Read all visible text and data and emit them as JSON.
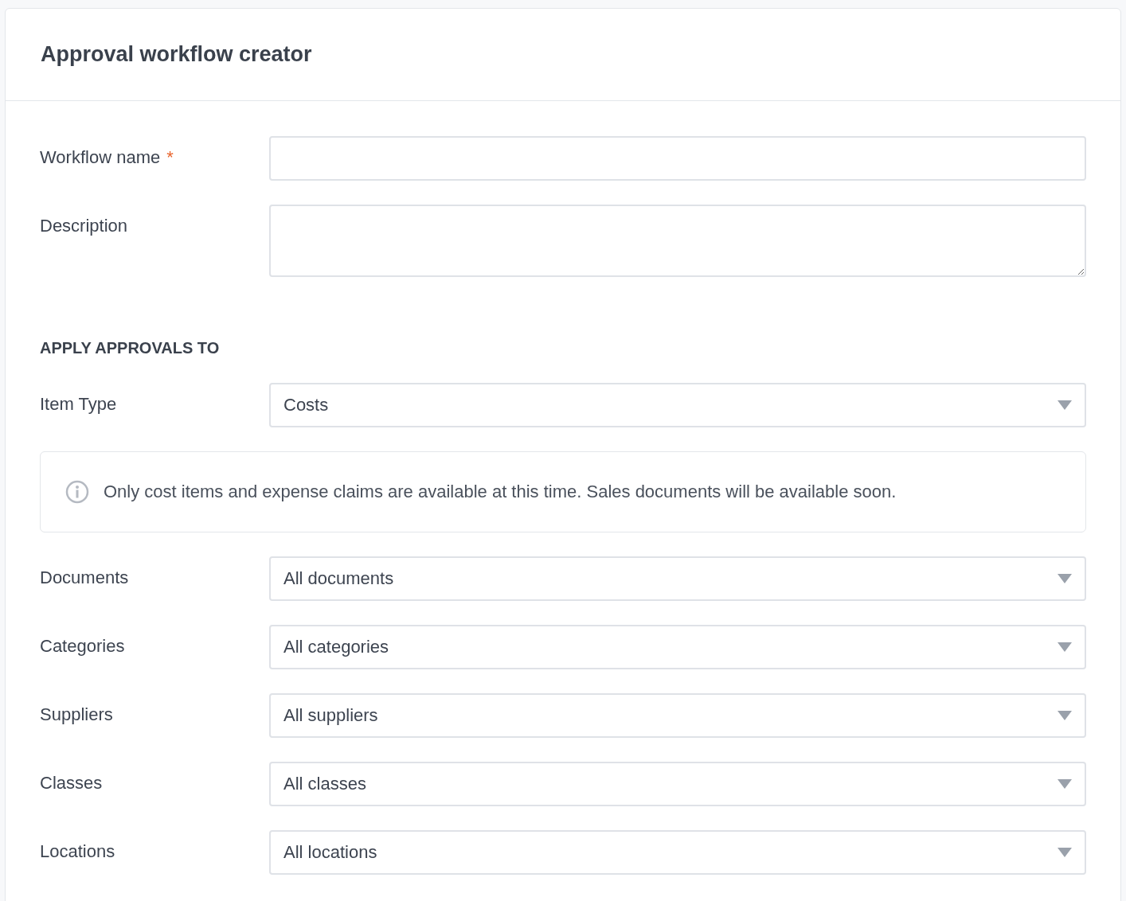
{
  "title": "Approval workflow creator",
  "fields": [
    {
      "label": "Workflow name",
      "required_mark": "*",
      "kind": "text"
    },
    {
      "label": "Description",
      "kind": "textarea"
    }
  ],
  "section_heading": "APPLY APPROVALS TO",
  "item_type": {
    "label": "Item Type",
    "value": "Costs"
  },
  "info": "Only cost items and expense claims are available at this time. Sales documents will be available soon.",
  "filters": [
    {
      "label": "Documents",
      "value": "All documents"
    },
    {
      "label": "Categories",
      "value": "All categories"
    },
    {
      "label": "Suppliers",
      "value": "All suppliers"
    },
    {
      "label": "Classes",
      "value": "All classes"
    },
    {
      "label": "Locations",
      "value": "All locations"
    }
  ]
}
